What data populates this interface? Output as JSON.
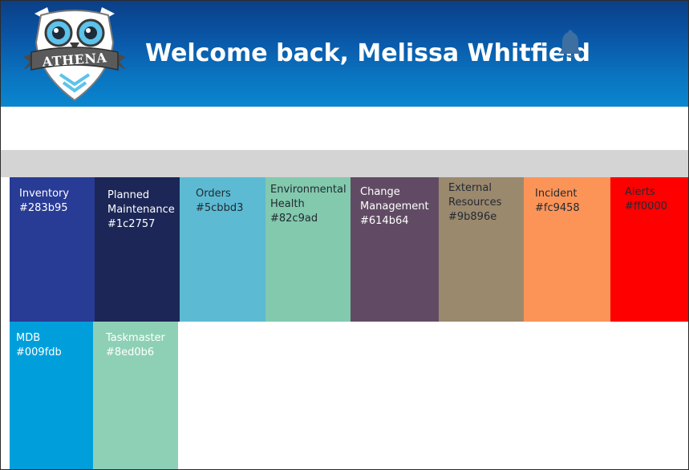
{
  "header": {
    "logo_text": "ATHENA",
    "welcome": "Welcome back, Melissa Whitfield",
    "bell_icon": "bell-icon"
  },
  "tiles": [
    {
      "name": "Inventory",
      "hex": "#283b95",
      "color": "#283b95",
      "text": "light"
    },
    {
      "name": "Planned\nMaintenance",
      "hex": "#1c2757",
      "color": "#1c2757",
      "text": "light"
    },
    {
      "name": "Orders",
      "hex": "#5cbbd3",
      "color": "#5cbbd3",
      "text": "dark"
    },
    {
      "name": "Environmental\nHealth",
      "hex": "#82c9ad",
      "color": "#82c9ad",
      "text": "dark"
    },
    {
      "name": "Change\nManagement",
      "hex": "#614b64",
      "color": "#614b64",
      "text": "light"
    },
    {
      "name": "External\nResources",
      "hex": "#9b896e",
      "color": "#9b896e",
      "text": "dark"
    },
    {
      "name": "Incident",
      "hex": "#fc9458",
      "color": "#fc9458",
      "text": "dark"
    },
    {
      "name": "Alerts",
      "hex": "#ff0000",
      "color": "#ff0000",
      "text": "dark"
    },
    {
      "name": "MDB",
      "hex": "#009fdb",
      "color": "#009fdb",
      "text": "light"
    },
    {
      "name": "Taskmaster",
      "hex": "#8ed0b6",
      "color": "#8ed0b6",
      "text": "light"
    }
  ]
}
